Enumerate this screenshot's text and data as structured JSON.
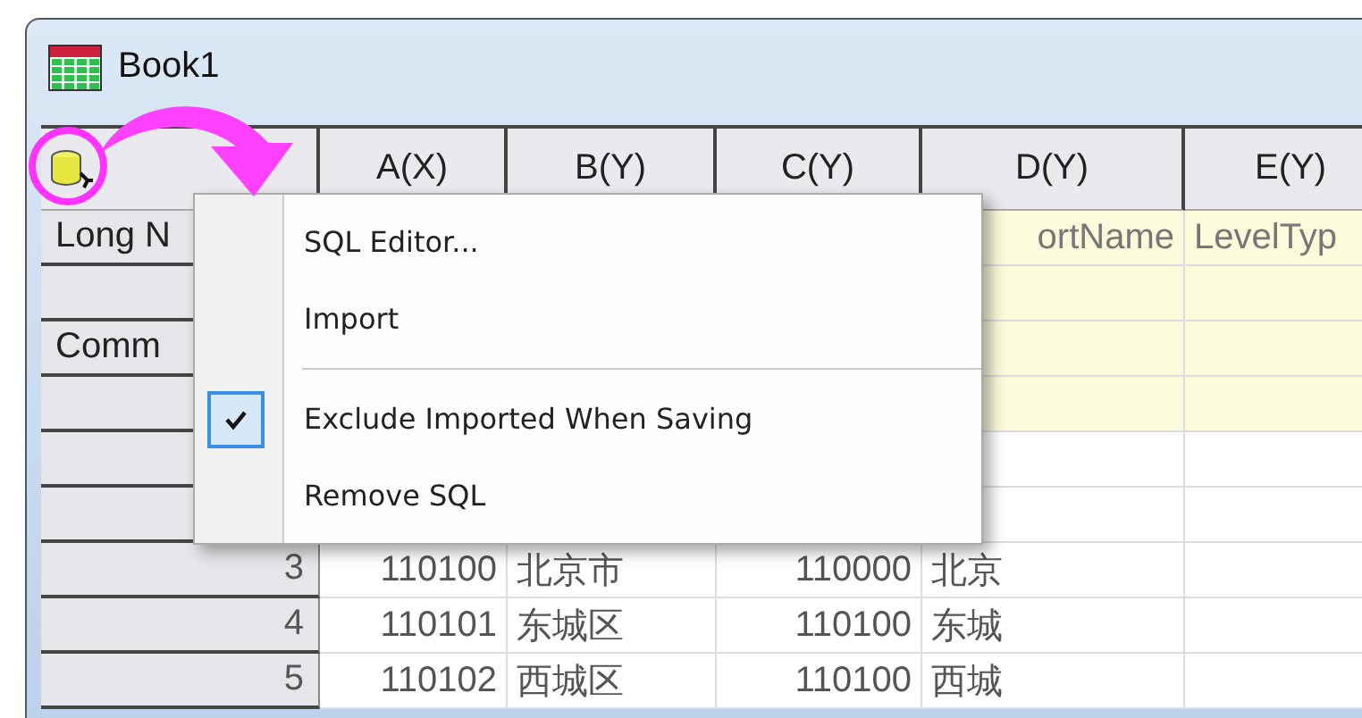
{
  "window": {
    "title": "Book1"
  },
  "table": {
    "columns": [
      "A(X)",
      "B(Y)",
      "C(Y)",
      "D(Y)",
      "E(Y)"
    ],
    "rows": [
      {
        "kind": "meta",
        "header": "Long N",
        "cells": [
          null,
          null,
          null,
          "ortName",
          "LevelTyp"
        ]
      },
      {
        "kind": "meta",
        "header": null,
        "cells": [
          null,
          null,
          null,
          null,
          null
        ]
      },
      {
        "kind": "meta",
        "header": "Comm",
        "cells": [
          null,
          null,
          null,
          null,
          null
        ]
      },
      {
        "kind": "meta",
        "header": null,
        "cells": [
          null,
          null,
          null,
          null,
          null
        ]
      },
      {
        "kind": "data",
        "header": null,
        "cells": [
          null,
          null,
          null,
          null,
          null
        ]
      },
      {
        "kind": "data",
        "header": null,
        "cells": [
          null,
          null,
          null,
          null,
          null
        ]
      },
      {
        "kind": "data",
        "header": "3",
        "cells": [
          "110100",
          "北京市",
          "110000",
          "北京",
          null
        ]
      },
      {
        "kind": "data",
        "header": "4",
        "cells": [
          "110101",
          "东城区",
          "110100",
          "东城",
          null
        ]
      },
      {
        "kind": "data",
        "header": "5",
        "cells": [
          "110102",
          "西城区",
          "110100",
          "西城",
          null
        ]
      }
    ]
  },
  "context_menu": {
    "items": [
      {
        "kind": "item",
        "label": "SQL Editor...",
        "checked": false
      },
      {
        "kind": "item",
        "label": "Import",
        "checked": false
      },
      {
        "kind": "separator"
      },
      {
        "kind": "item",
        "label": "Exclude Imported When Saving",
        "checked": true
      },
      {
        "kind": "item",
        "label": "Remove SQL",
        "checked": false
      }
    ]
  }
}
